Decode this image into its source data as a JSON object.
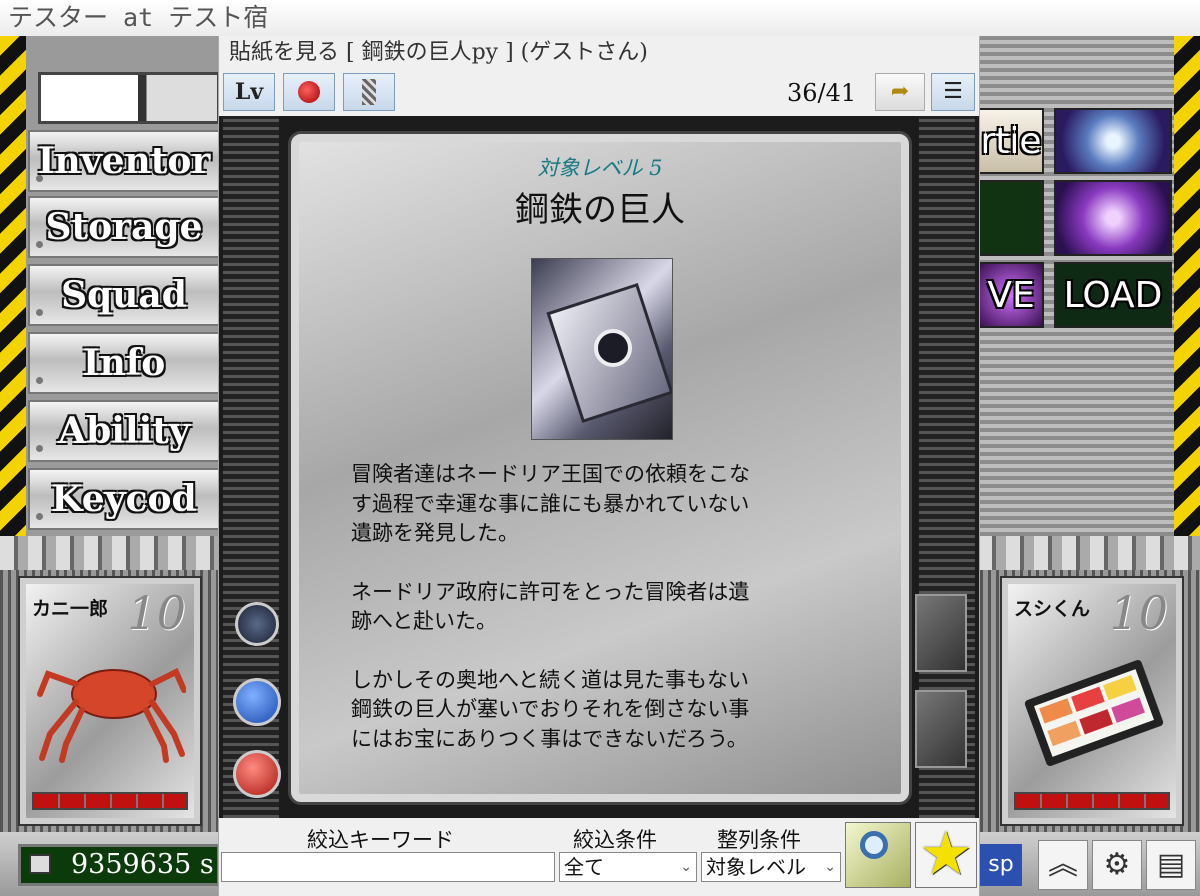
{
  "window": {
    "title": "テスター at テスト宿"
  },
  "left_menu": {
    "items": [
      {
        "label": "Inventor"
      },
      {
        "label": "Storage"
      },
      {
        "label": "Squad"
      },
      {
        "label": "Info"
      },
      {
        "label": "Ability"
      },
      {
        "label": "Keycod"
      }
    ]
  },
  "right_panel": {
    "party_tile": "rtie",
    "save_tile": "VE",
    "load_tile": "LOAD"
  },
  "party": [
    {
      "name": "カニ一郎",
      "level": "10"
    },
    {
      "name": "スシくん",
      "level": "10"
    }
  ],
  "bottom_bar": {
    "money": "9359635",
    "money_suffix": "s",
    "sp_label": "sp",
    "icons": [
      "chevron-up-icon",
      "gear-icon",
      "book-icon"
    ]
  },
  "dialog": {
    "title": "貼紙を見る [ 鋼鉄の巨人py ] (ゲストさん)",
    "toolbar": {
      "level_button": "Lv",
      "page_counter": "36/41"
    },
    "sheet": {
      "target_level": "対象レベル 5",
      "title": "鋼鉄の巨人",
      "paragraphs": [
        "冒険者達はネードリア王国での依頼をこな\nす過程で幸運な事に誰にも暴かれていない\n遺跡を発見した。",
        "ネードリア政府に許可をとった冒険者は遺\n跡へと赴いた。",
        "しかしその奥地へと続く道は見た事もない\n鋼鉄の巨人が塞いでおりそれを倒さない事\nにはお宝にありつく事はできないだろう。"
      ]
    },
    "filter": {
      "keyword_label": "絞込キーワード",
      "keyword_value": "",
      "condition_label": "絞込条件",
      "condition_value": "全て",
      "sort_label": "整列条件",
      "sort_value": "対象レベル"
    }
  },
  "colors": {
    "target_level": "#177a82",
    "hazard_yellow": "#f4d400",
    "money_bg": "#0b3b0b",
    "sp_blue": "#2b50b0",
    "star": "#f5e100"
  }
}
